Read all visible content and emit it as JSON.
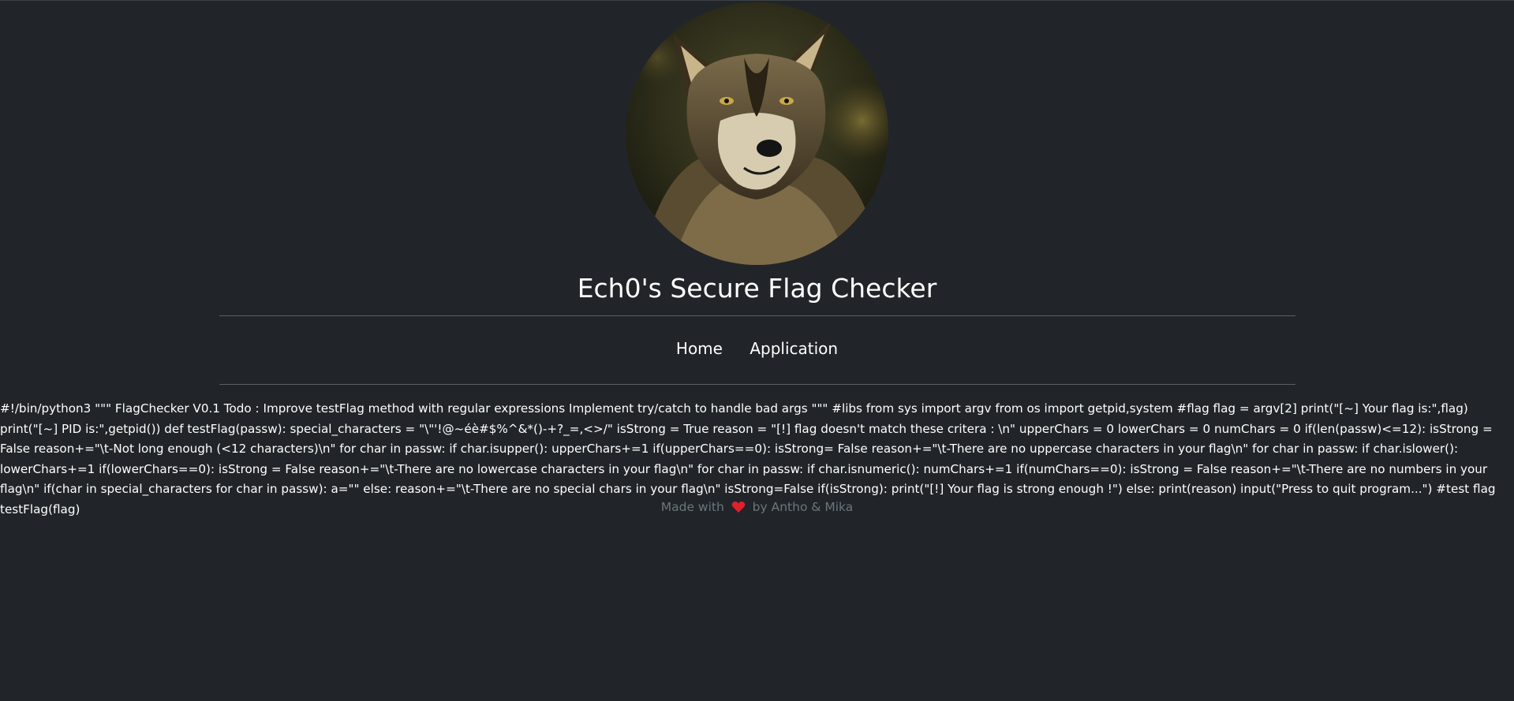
{
  "header": {
    "avatar_alt": "wolf"
  },
  "title": "Ech0's Secure Flag Checker",
  "nav": {
    "home": "Home",
    "application": "Application"
  },
  "code": "#!/bin/python3 \"\"\" FlagChecker V0.1 Todo : Improve testFlag method with regular expressions Implement try/catch to handle bad args \"\"\" #libs from sys import argv from os import getpid,system #flag flag = argv[2] print(\"[~] Your flag is:\",flag) print(\"[~] PID is:\",getpid()) def testFlag(passw): special_characters = \"\\\"'!@~éè#$%^&*()-+?_=,<>/\" isStrong = True reason = \"[!] flag doesn't match these critera : \\n\" upperChars = 0 lowerChars = 0 numChars = 0 if(len(passw)<=12): isStrong = False reason+=\"\\t-Not long enough (<12 characters)\\n\" for char in passw: if char.isupper(): upperChars+=1 if(upperChars==0): isStrong= False reason+=\"\\t-There are no uppercase characters in your flag\\n\" for char in passw: if char.islower(): lowerChars+=1 if(lowerChars==0): isStrong = False reason+=\"\\t-There are no lowercase characters in your flag\\n\" for char in passw: if char.isnumeric(): numChars+=1 if(numChars==0): isStrong = False reason+=\"\\t-There are no numbers in your flag\\n\" if(char in special_characters for char in passw): a=\"\" else: reason+=\"\\t-There are no special chars in your flag\\n\" isStrong=False if(isStrong): print(\"[!] Your flag is strong enough !\") else: print(reason) input(\"Press to quit program...\") #test flag testFlag(flag)",
  "footer": {
    "made_with": "Made with",
    "by": "by Antho & Mika"
  },
  "colors": {
    "background": "#212529",
    "text": "#ffffff",
    "muted": "#6c757d",
    "heart": "#e0202a"
  }
}
